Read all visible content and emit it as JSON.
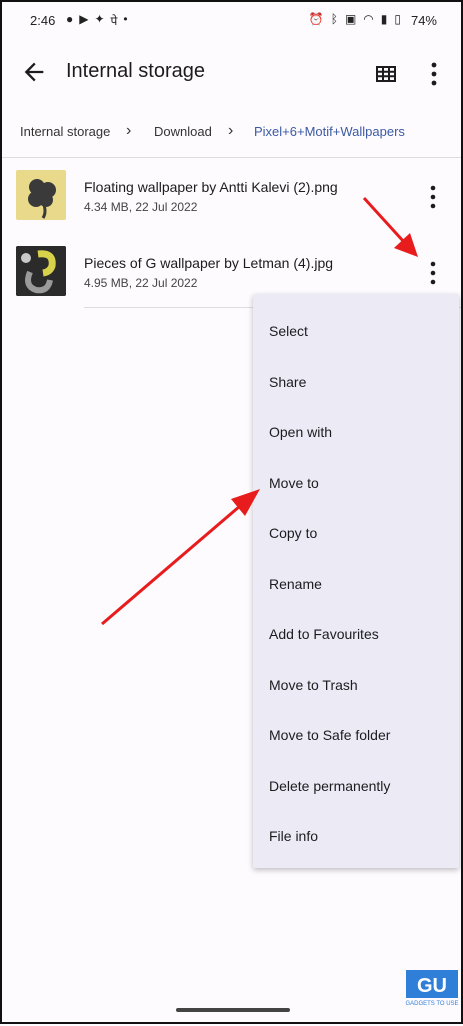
{
  "status_bar": {
    "time": "2:46",
    "battery": "74%"
  },
  "app_bar": {
    "title": "Internal storage"
  },
  "breadcrumbs": [
    "Internal storage",
    "Download",
    "Pixel+6+Motif+Wallpapers"
  ],
  "files": [
    {
      "name": "Floating wallpaper by Antti Kalevi (2).png",
      "meta": "4.34 MB, 22 Jul 2022"
    },
    {
      "name": "Pieces of G wallpaper by Letman (4).jpg",
      "meta": "4.95 MB, 22 Jul 2022"
    }
  ],
  "context_menu": {
    "items": [
      "Select",
      "Share",
      "Open with",
      "Move to",
      "Copy to",
      "Rename",
      "Add to Favourites",
      "Move to Trash",
      "Move to Safe folder",
      "Delete permanently",
      "File info"
    ]
  },
  "colors": {
    "accent": "#3b5aa3",
    "menu_bg": "#ecebf5",
    "arrow": "#e81c1c"
  },
  "watermark": {
    "text": "GADGETS TO USE"
  }
}
